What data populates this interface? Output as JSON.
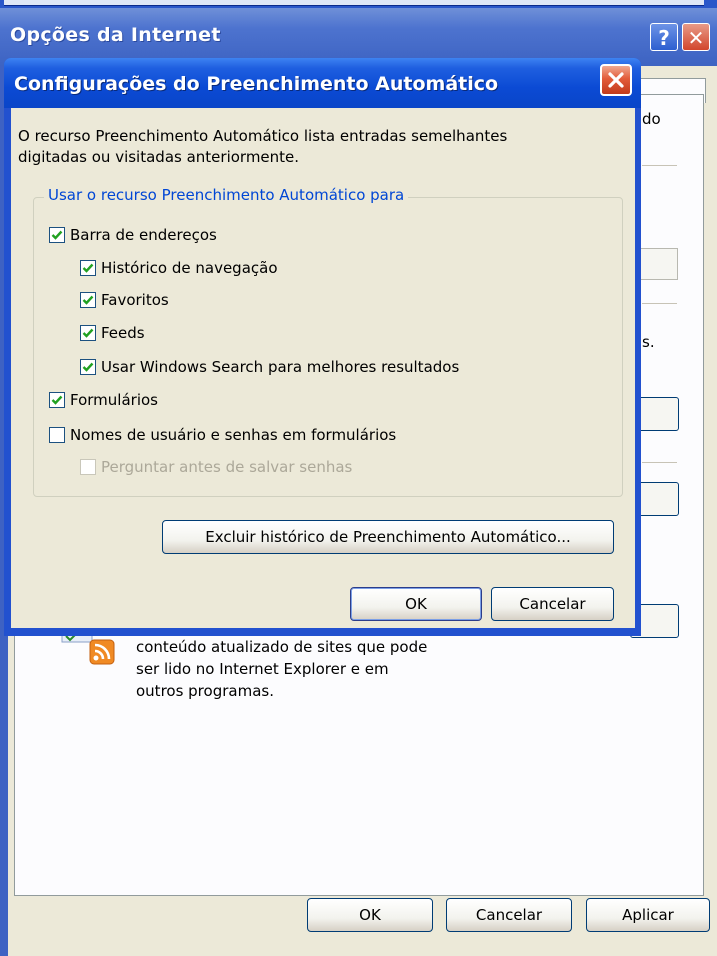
{
  "outer_window": {
    "title": "Opções da Internet",
    "help_glyph": "?",
    "close_glyph": "✕",
    "partial_text_1": "do",
    "partial_text_2": "s.",
    "feed_lines": [
      "conteúdo atualizado de sites que pode",
      "ser lido no Internet Explorer e em",
      "outros programas."
    ],
    "buttons": {
      "ok": "OK",
      "cancel": "Cancelar",
      "apply": "Aplicar"
    }
  },
  "dialog": {
    "title": "Configurações do Preenchimento Automático",
    "description_lines": [
      "O recurso Preenchimento Automático lista entradas semelhantes",
      "digitadas ou visitadas anteriormente."
    ],
    "group_label": "Usar o recurso Preenchimento Automático para",
    "options": [
      {
        "label": "Barra de endereços",
        "checked": true,
        "enabled": true,
        "indent": 0
      },
      {
        "label": "Histórico de navegação",
        "checked": true,
        "enabled": true,
        "indent": 1
      },
      {
        "label": "Favoritos",
        "checked": true,
        "enabled": true,
        "indent": 1
      },
      {
        "label": "Feeds",
        "checked": true,
        "enabled": true,
        "indent": 1
      },
      {
        "label": "Usar Windows Search para melhores resultados",
        "checked": true,
        "enabled": true,
        "indent": 1
      },
      {
        "label": "Formulários",
        "checked": true,
        "enabled": true,
        "indent": 0
      },
      {
        "label": "Nomes de usuário e senhas em formulários",
        "checked": false,
        "enabled": true,
        "indent": 0
      },
      {
        "label": "Perguntar antes de salvar senhas",
        "checked": false,
        "enabled": false,
        "indent": 1
      }
    ],
    "clear_history_button": "Excluir histórico de Preenchimento Automático...",
    "ok_button": "OK",
    "cancel_button": "Cancelar"
  },
  "colors": {
    "dialog_title_blue": "#0a4ad4",
    "outer_title_blue": "#4d73cf",
    "group_label_blue": "#0046d5",
    "dialog_face": "#ece9d8",
    "close_red": "#d2462c",
    "checkmark_green": "#21a121"
  }
}
